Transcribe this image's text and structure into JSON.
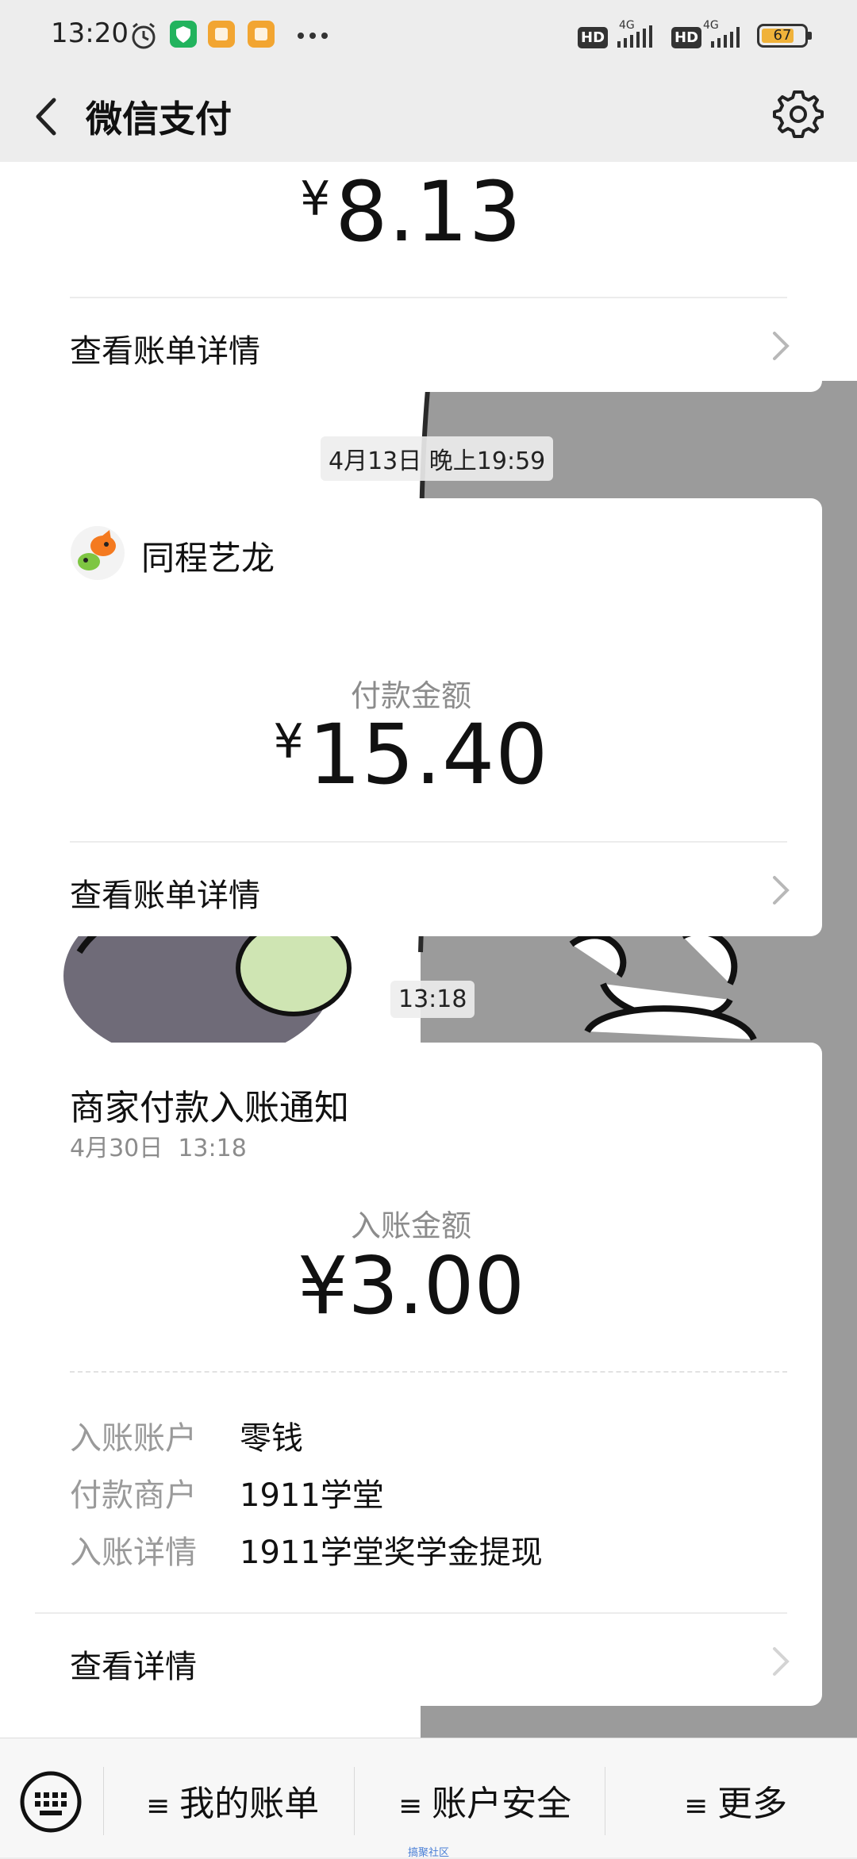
{
  "status_bar": {
    "time": "13:20",
    "network_left": "4G",
    "network_right": "4G",
    "hd_left": "HD",
    "hd_right": "HD",
    "battery": "67"
  },
  "nav": {
    "title": "微信支付"
  },
  "messages": [
    {
      "amount_currency": "¥",
      "amount_value": "8.13",
      "view_label": "查看账单详情"
    },
    {
      "timestamp": "4月13日 晚上19:59",
      "merchant": "同程艺龙",
      "amount_label": "付款金额",
      "amount_currency": "¥",
      "amount_value": "15.40",
      "view_label": "查看账单详情"
    },
    {
      "timestamp": "13:18",
      "title": "商家付款入账通知",
      "subtitle": "4月30日  13:18",
      "amount_label": "入账金额",
      "amount_text": "¥3.00",
      "details": [
        {
          "key": "入账账户",
          "value": "零钱"
        },
        {
          "key": "付款商户",
          "value": "1911学堂"
        },
        {
          "key": "入账详情",
          "value": "1911学堂奖学金提现"
        }
      ],
      "view_label": "查看详情"
    }
  ],
  "bottom_bar": {
    "menus": [
      "我的账单",
      "账户安全",
      "更多"
    ],
    "hamburger": "≡"
  },
  "watermark": "搞聚社区",
  "colors": {
    "page_bg": "#ededed",
    "card_bg": "#ffffff",
    "muted_text": "#8c8c8c",
    "battery_fill": "#f0b23a"
  }
}
